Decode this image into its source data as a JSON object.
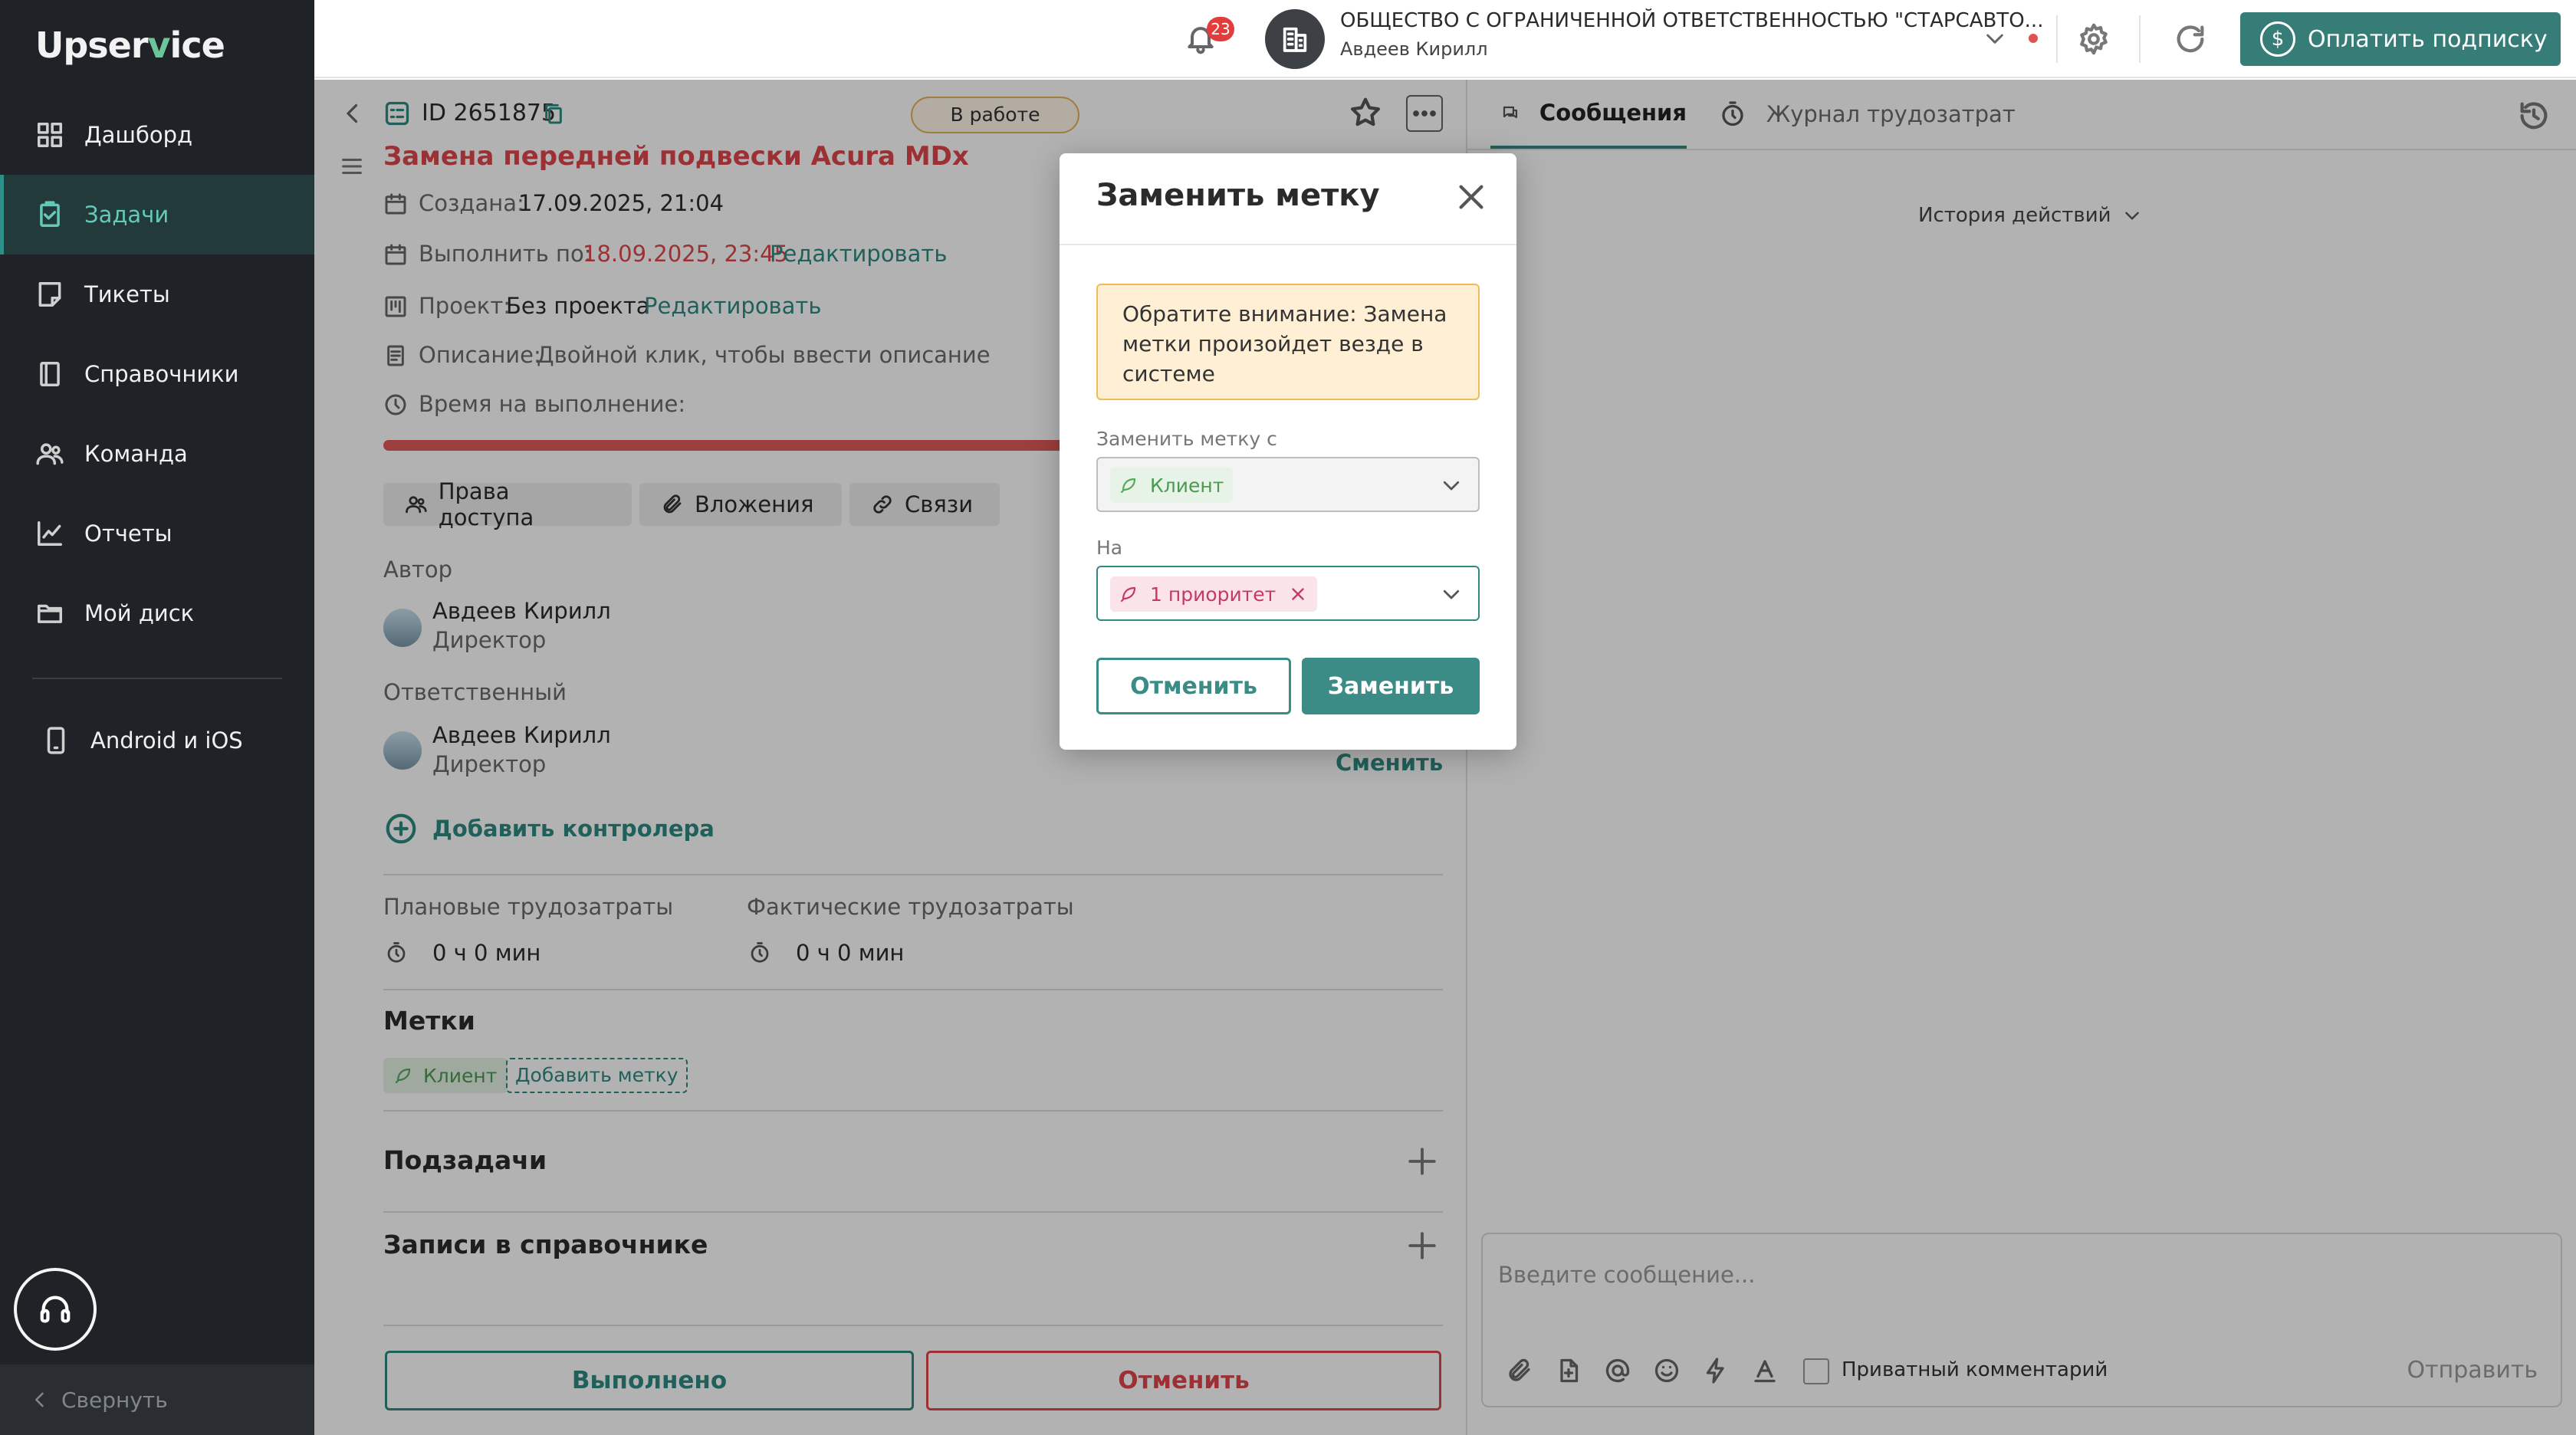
{
  "app": {
    "logo_pre": "Upser",
    "logo_v": "v",
    "logo_post": "ice"
  },
  "sidebar": {
    "items": [
      {
        "label": "Дашборд",
        "icon": "dashboard-icon"
      },
      {
        "label": "Задачи",
        "icon": "tasks-icon",
        "active": true
      },
      {
        "label": "Тикеты",
        "icon": "tickets-icon"
      },
      {
        "label": "Справочники",
        "icon": "book-icon"
      },
      {
        "label": "Команда",
        "icon": "team-icon"
      },
      {
        "label": "Отчеты",
        "icon": "reports-icon"
      },
      {
        "label": "Мой диск",
        "icon": "folder-icon"
      }
    ],
    "mobile": {
      "label": "Android и iOS",
      "icon": "phone-icon"
    },
    "collapse_label": "Свернуть",
    "support_icon": "headset-icon"
  },
  "topbar": {
    "notifications_count": "23",
    "org_name": "ОБЩЕСТВО С ОГРАНИЧЕННОЙ ОТВЕТСТВЕННОСТЬЮ \"СТАРСАВТО...",
    "org_user": "Авдеев Кирилл",
    "pay_label": "Оплатить подписку",
    "pay_symbol": "$"
  },
  "task": {
    "id_label": "ID 2651875",
    "status": "В работе",
    "title": "Замена передней подвески Acura MDx",
    "created_label": "Создана:",
    "created_value": "17.09.2025, 21:04",
    "due_label": "Выполнить по:",
    "due_value": "18.09.2025, 23:45",
    "edit_label": "Редактировать",
    "project_label": "Проект:",
    "project_value": "Без проекта",
    "description_label": "Описание:",
    "description_placeholder": "Двойной клик, чтобы ввести описание",
    "time_label": "Время на выполнение:",
    "chips": {
      "access": "Права доступа",
      "attachments": "Вложения",
      "links": "Связи"
    },
    "author_label": "Автор",
    "author_name": "Авдеев Кирилл",
    "author_role": "Директор",
    "responsible_label": "Ответственный",
    "responsible_name": "Авдеев Кирилл",
    "responsible_role": "Директор",
    "change_label": "Сменить",
    "add_controller": "Добавить контролера",
    "planned_label": "Плановые трудозатраты",
    "planned_value": "0 ч 0 мин",
    "actual_label": "Фактические трудозатраты",
    "actual_value": "0 ч 0 мин",
    "tags_title": "Метки",
    "tag_client": "Клиент",
    "add_tag": "Добавить метку",
    "subtasks_title": "Подзадачи",
    "records_title": "Записи в справочнике",
    "done_btn": "Выполнено",
    "cancel_btn": "Отменить"
  },
  "right_panel": {
    "tab_messages": "Сообщения",
    "tab_journal": "Журнал трудозатрат",
    "history_actions": "История действий",
    "message_placeholder": "Введите сообщение...",
    "private_comment": "Приватный комментарий",
    "send_label": "Отправить"
  },
  "modal": {
    "title": "Заменить метку",
    "notice": "Обратите внимание: Замена метки произойдет везде в системе",
    "from_label": "Заменить метку с",
    "from_value": "Клиент",
    "to_label": "На",
    "to_value": "1 приоритет",
    "cancel_label": "Отменить",
    "confirm_label": "Заменить"
  },
  "colors": {
    "accent": "#367d78",
    "danger": "#e0474c",
    "sidebar": "#1f2226",
    "warning": "#efbd55"
  }
}
